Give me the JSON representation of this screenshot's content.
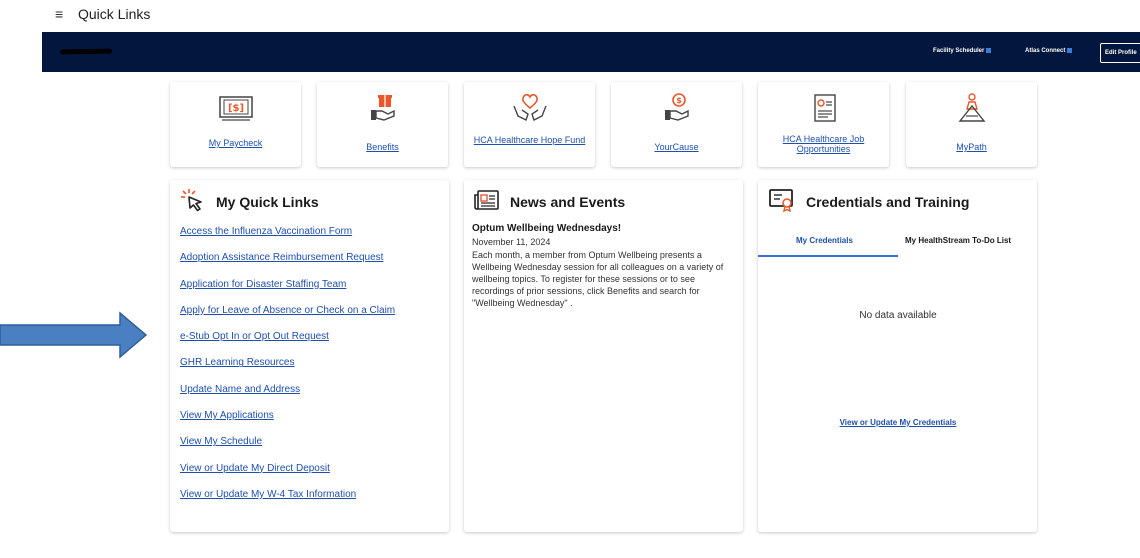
{
  "topbar": {
    "menu_icon": "hamburger-icon",
    "title": "Quick Links"
  },
  "navbar": {
    "background": "#03173e",
    "links": [
      {
        "label": "Facility Scheduler",
        "icon": "external-link-icon"
      },
      {
        "label": "Atlas Connect",
        "icon": "external-link-icon"
      }
    ],
    "edit_profile": "Edit Profile"
  },
  "tiles": [
    {
      "label": "My Paycheck",
      "icon": "paycheck-icon"
    },
    {
      "label": "Benefits",
      "icon": "gift-hand-icon"
    },
    {
      "label": "HCA Healthcare Hope Fund",
      "icon": "heart-hands-icon"
    },
    {
      "label": "YourCause",
      "icon": "donation-hand-icon"
    },
    {
      "label": "HCA Healthcare Job Opportunities",
      "icon": "resume-icon"
    },
    {
      "label": "MyPath",
      "icon": "path-person-icon"
    }
  ],
  "quick_links": {
    "title": "My Quick Links",
    "icon": "cursor-click-icon",
    "items": [
      "Access the Influenza Vaccination Form",
      "Adoption Assistance Reimbursement Request",
      "Application for Disaster Staffing Team",
      "Apply for Leave of Absence or Check on a Claim",
      "e-Stub Opt In or Opt Out Request",
      "GHR Learning Resources",
      "Update Name and Address",
      "View My Applications",
      "View My Schedule",
      "View or Update My Direct Deposit",
      "View or Update My W-4 Tax Information"
    ]
  },
  "news": {
    "title": "News and Events",
    "icon": "newspaper-icon",
    "item_title": "Optum Wellbeing Wednesdays!",
    "item_date": "November 11, 2024",
    "item_body": "Each month, a member from Optum Wellbeing presents a Wellbeing Wednesday session for all colleagues on a variety of wellbeing topics. To register for these sessions or to see recordings of prior sessions, click Benefits and search for \"Wellbeing Wednesday\" ."
  },
  "credentials": {
    "title": "Credentials and Training",
    "icon": "certificate-icon",
    "tabs": [
      "My Credentials",
      "My HealthStream To-Do List"
    ],
    "empty_text": "No data available",
    "link": "View or Update My Credentials"
  },
  "annotation": {
    "icon": "pointer-arrow-icon",
    "color": "#4a7fc1"
  },
  "colors": {
    "accent_orange": "#e8582a",
    "link_blue": "#1f4fae"
  }
}
